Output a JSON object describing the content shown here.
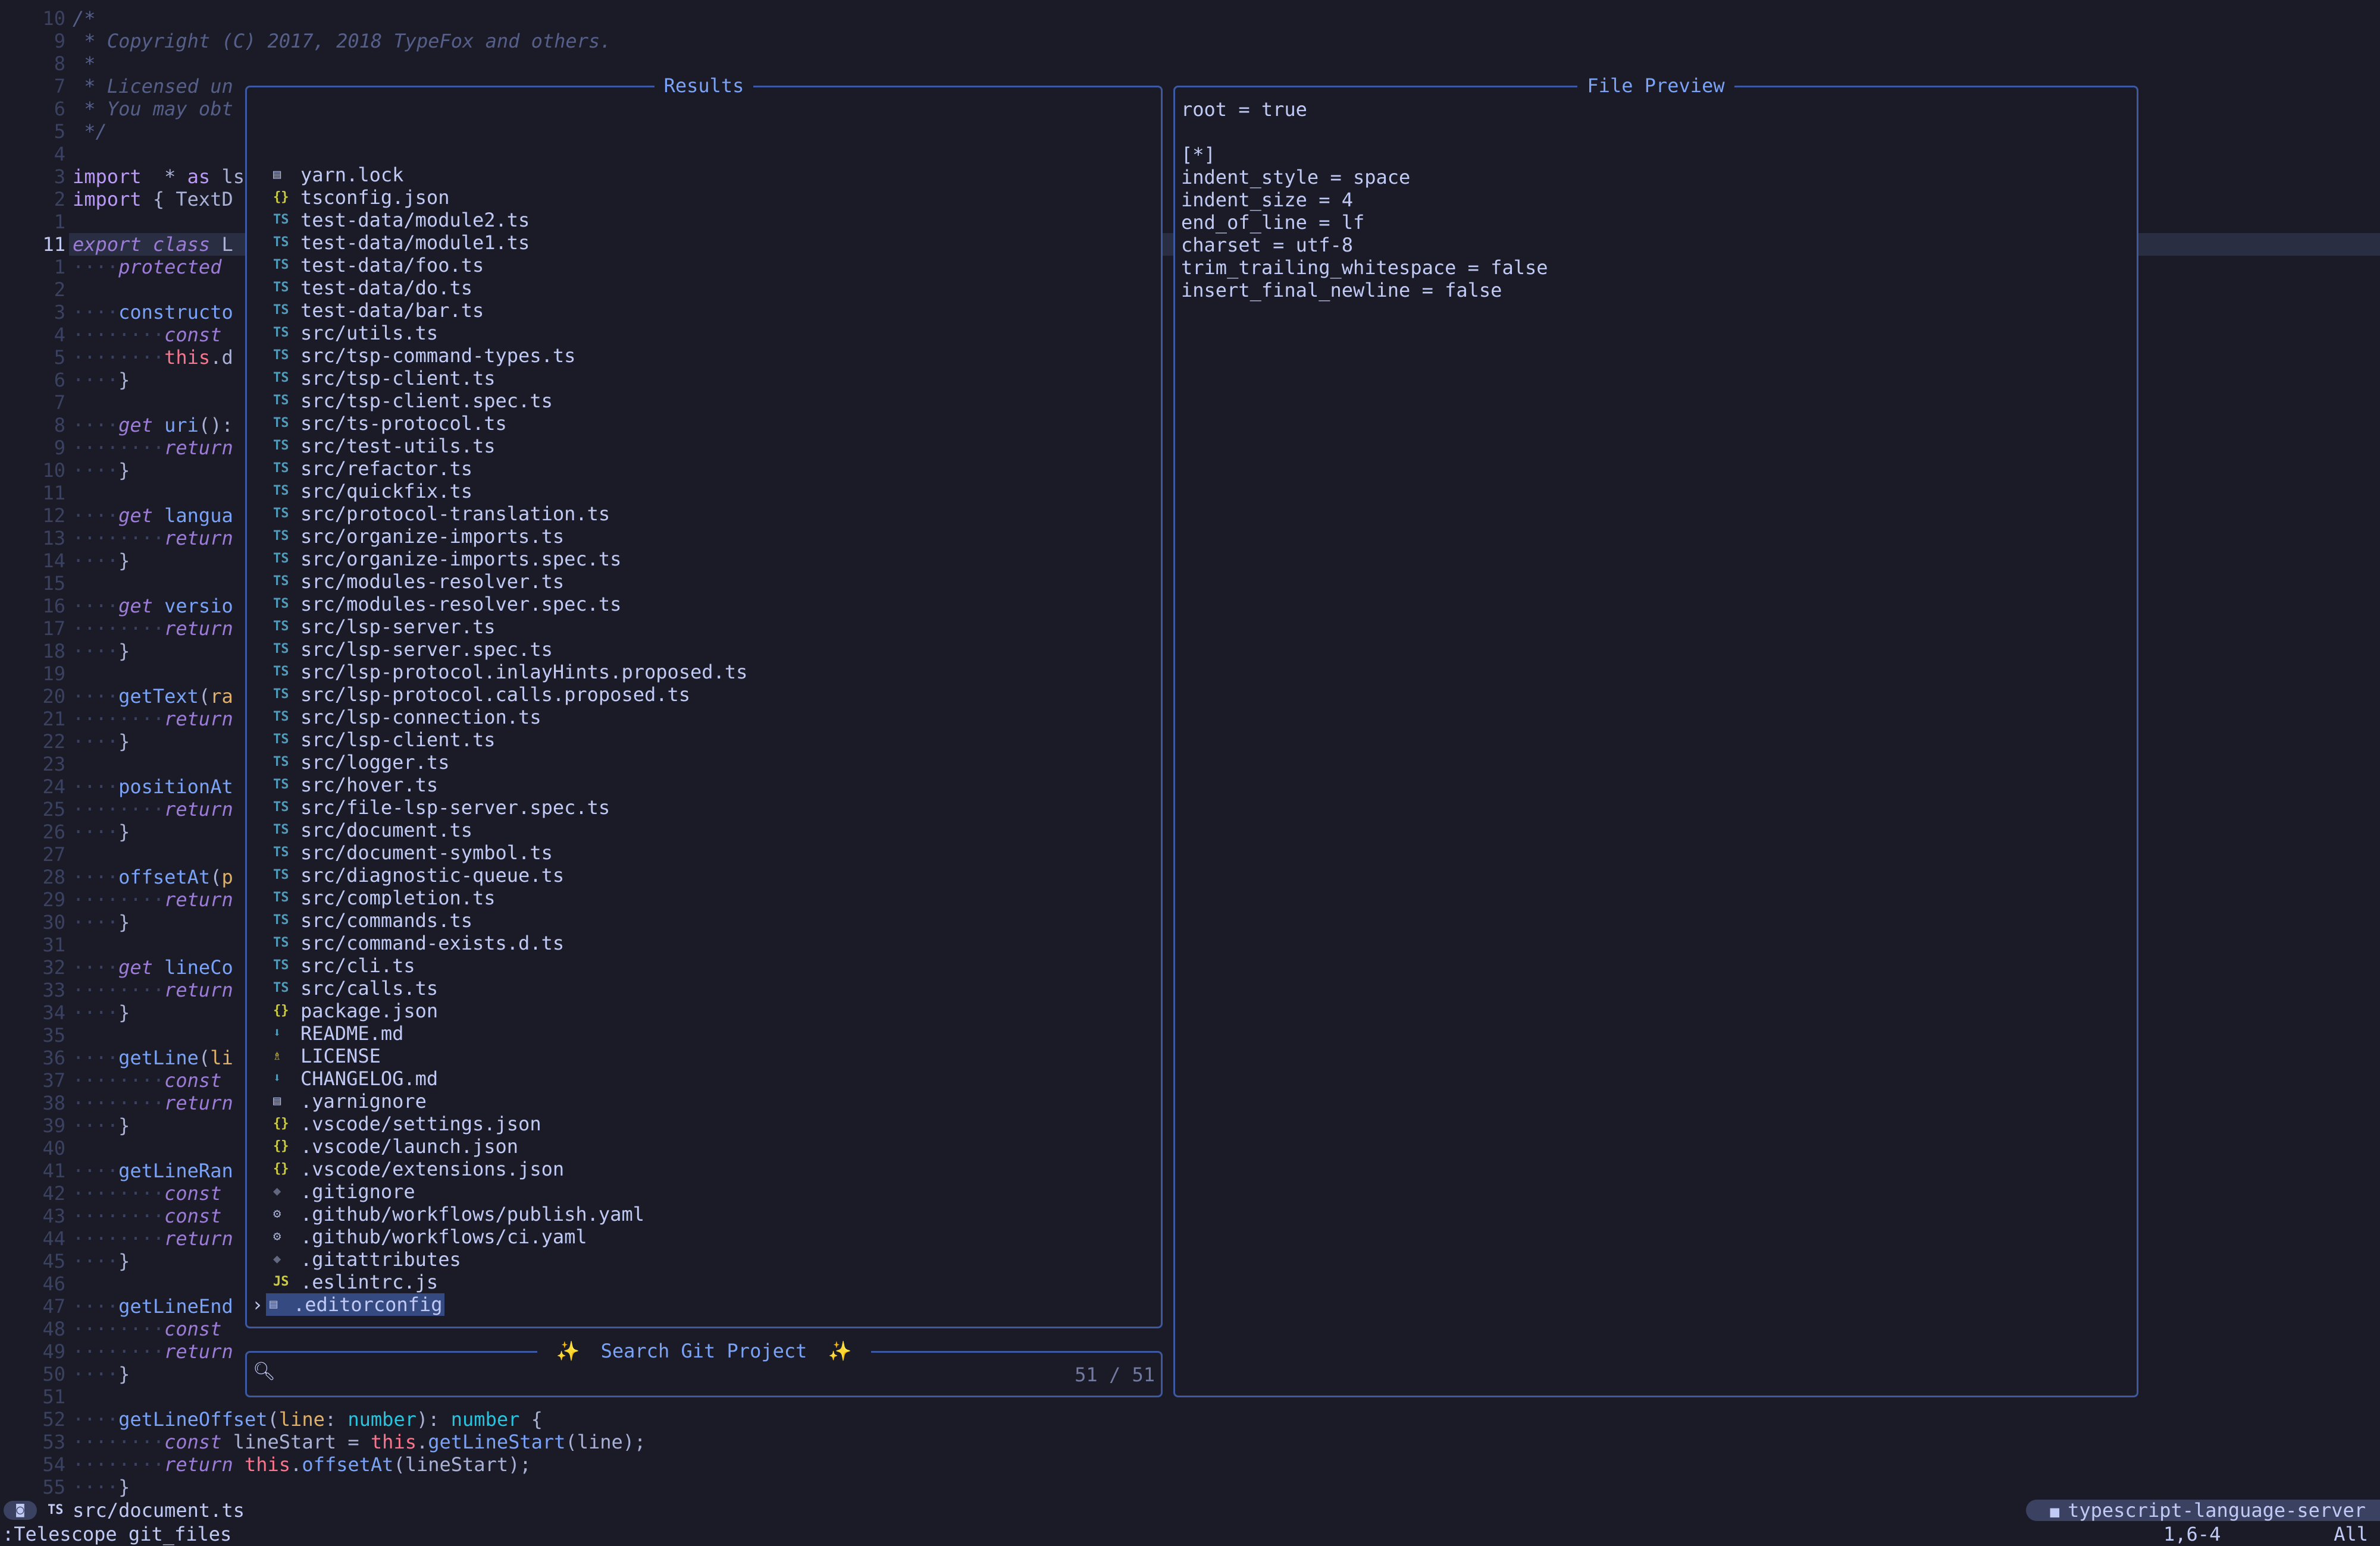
{
  "editor": {
    "line_numbers": [
      "10",
      "9",
      "8",
      "7",
      "6",
      "5",
      "4",
      "3",
      "2",
      "1",
      "11",
      "1",
      "2",
      "3",
      "4",
      "5",
      "6",
      "7",
      "8",
      "9",
      "10",
      "11",
      "12",
      "13",
      "14",
      "15",
      "16",
      "17",
      "18",
      "19",
      "20",
      "21",
      "22",
      "23",
      "24",
      "25",
      "26",
      "27",
      "28",
      "29",
      "30",
      "31",
      "32",
      "33",
      "34",
      "35",
      "36",
      "37",
      "38",
      "39",
      "40",
      "41",
      "42",
      "43",
      "44",
      "45",
      "46",
      "47",
      "48",
      "49",
      "50",
      "51",
      "52",
      "53",
      "54",
      "55"
    ],
    "lines": [
      [
        [
          "cm",
          "/*"
        ]
      ],
      [
        [
          "cm",
          " * Copyright (C) 2017, 2018 TypeFox and others."
        ]
      ],
      [
        [
          "cm",
          " *"
        ]
      ],
      [
        [
          "cm",
          " * Licensed un"
        ]
      ],
      [
        [
          "cm",
          " * You may obt"
        ]
      ],
      [
        [
          "cm",
          " */"
        ]
      ],
      [],
      [
        [
          "kw2",
          "import"
        ],
        [
          "",
          "  * "
        ],
        [
          "kw2",
          "as"
        ],
        [
          "",
          " ls"
        ]
      ],
      [
        [
          "kw2",
          "import"
        ],
        [
          "",
          " { TextD"
        ]
      ],
      [],
      [
        [
          "kw",
          "export class"
        ],
        [
          "",
          " L"
        ]
      ],
      [
        [
          "ws",
          "····"
        ],
        [
          "kw",
          "protected"
        ]
      ],
      [],
      [
        [
          "ws",
          "····"
        ],
        [
          "fn",
          "constructo"
        ]
      ],
      [
        [
          "ws",
          "········"
        ],
        [
          "kw",
          "const"
        ]
      ],
      [
        [
          "ws",
          "········"
        ],
        [
          "th",
          "this"
        ],
        [
          "",
          ".d"
        ]
      ],
      [
        [
          "ws",
          "····"
        ],
        [
          "",
          "}"
        ]
      ],
      [],
      [
        [
          "ws",
          "····"
        ],
        [
          "kw",
          "get"
        ],
        [
          "",
          " "
        ],
        [
          "fn",
          "uri"
        ],
        [
          "",
          "():"
        ]
      ],
      [
        [
          "ws",
          "········"
        ],
        [
          "kw",
          "return"
        ]
      ],
      [
        [
          "ws",
          "····"
        ],
        [
          "",
          "}"
        ]
      ],
      [],
      [
        [
          "ws",
          "····"
        ],
        [
          "kw",
          "get"
        ],
        [
          "",
          " "
        ],
        [
          "fn",
          "langua"
        ]
      ],
      [
        [
          "ws",
          "········"
        ],
        [
          "kw",
          "return"
        ]
      ],
      [
        [
          "ws",
          "····"
        ],
        [
          "",
          "}"
        ]
      ],
      [],
      [
        [
          "ws",
          "····"
        ],
        [
          "kw",
          "get"
        ],
        [
          "",
          " "
        ],
        [
          "fn",
          "versio"
        ]
      ],
      [
        [
          "ws",
          "········"
        ],
        [
          "kw",
          "return"
        ]
      ],
      [
        [
          "ws",
          "····"
        ],
        [
          "",
          "}"
        ]
      ],
      [],
      [
        [
          "ws",
          "····"
        ],
        [
          "fn",
          "getText"
        ],
        [
          "",
          "("
        ],
        [
          "pa",
          "ra"
        ]
      ],
      [
        [
          "ws",
          "········"
        ],
        [
          "kw",
          "return"
        ]
      ],
      [
        [
          "ws",
          "····"
        ],
        [
          "",
          "}"
        ]
      ],
      [],
      [
        [
          "ws",
          "····"
        ],
        [
          "fn",
          "positionAt"
        ]
      ],
      [
        [
          "ws",
          "········"
        ],
        [
          "kw",
          "return"
        ]
      ],
      [
        [
          "ws",
          "····"
        ],
        [
          "",
          "}"
        ]
      ],
      [],
      [
        [
          "ws",
          "····"
        ],
        [
          "fn",
          "offsetAt"
        ],
        [
          "",
          "("
        ],
        [
          "pa",
          "p"
        ]
      ],
      [
        [
          "ws",
          "········"
        ],
        [
          "kw",
          "return"
        ]
      ],
      [
        [
          "ws",
          "····"
        ],
        [
          "",
          "}"
        ]
      ],
      [],
      [
        [
          "ws",
          "····"
        ],
        [
          "kw",
          "get"
        ],
        [
          "",
          " "
        ],
        [
          "fn",
          "lineCo"
        ]
      ],
      [
        [
          "ws",
          "········"
        ],
        [
          "kw",
          "return"
        ]
      ],
      [
        [
          "ws",
          "····"
        ],
        [
          "",
          "}"
        ]
      ],
      [],
      [
        [
          "ws",
          "····"
        ],
        [
          "fn",
          "getLine"
        ],
        [
          "",
          "("
        ],
        [
          "pa",
          "li"
        ]
      ],
      [
        [
          "ws",
          "········"
        ],
        [
          "kw",
          "const"
        ]
      ],
      [
        [
          "ws",
          "········"
        ],
        [
          "kw",
          "return"
        ]
      ],
      [
        [
          "ws",
          "····"
        ],
        [
          "",
          "}"
        ]
      ],
      [],
      [
        [
          "ws",
          "····"
        ],
        [
          "fn",
          "getLineRan"
        ]
      ],
      [
        [
          "ws",
          "········"
        ],
        [
          "kw",
          "const"
        ]
      ],
      [
        [
          "ws",
          "········"
        ],
        [
          "kw",
          "const"
        ]
      ],
      [
        [
          "ws",
          "········"
        ],
        [
          "kw",
          "return"
        ]
      ],
      [
        [
          "ws",
          "····"
        ],
        [
          "",
          "}"
        ]
      ],
      [],
      [
        [
          "ws",
          "····"
        ],
        [
          "fn",
          "getLineEnd"
        ]
      ],
      [
        [
          "ws",
          "········"
        ],
        [
          "kw",
          "const"
        ]
      ],
      [
        [
          "ws",
          "········"
        ],
        [
          "kw",
          "return"
        ]
      ],
      [
        [
          "ws",
          "····"
        ],
        [
          "",
          "}"
        ]
      ],
      [],
      [
        [
          "ws",
          "····"
        ],
        [
          "fn",
          "getLineOffset"
        ],
        [
          "",
          "("
        ],
        [
          "pa",
          "line"
        ],
        [
          "",
          ": "
        ],
        [
          "ty",
          "number"
        ],
        [
          "",
          "): "
        ],
        [
          "ty",
          "number"
        ],
        [
          "",
          " {"
        ]
      ],
      [
        [
          "ws",
          "········"
        ],
        [
          "kw",
          "const"
        ],
        [
          "",
          " lineStart = "
        ],
        [
          "th",
          "this"
        ],
        [
          "",
          "."
        ],
        [
          "fn",
          "getLineStart"
        ],
        [
          "",
          "(line);"
        ]
      ],
      [
        [
          "ws",
          "········"
        ],
        [
          "kw",
          "return"
        ],
        [
          "",
          " "
        ],
        [
          "th",
          "this"
        ],
        [
          "",
          "."
        ],
        [
          "fn",
          "offsetAt"
        ],
        [
          "",
          "(lineStart);"
        ]
      ],
      [
        [
          "ws",
          "····"
        ],
        [
          "",
          "}"
        ]
      ]
    ]
  },
  "results": {
    "title": "Results",
    "items": [
      {
        "icon": "doc",
        "label": "yarn.lock"
      },
      {
        "icon": "json",
        "label": "tsconfig.json"
      },
      {
        "icon": "ts",
        "label": "test-data/module2.ts"
      },
      {
        "icon": "ts",
        "label": "test-data/module1.ts"
      },
      {
        "icon": "ts",
        "label": "test-data/foo.ts"
      },
      {
        "icon": "ts",
        "label": "test-data/do.ts"
      },
      {
        "icon": "ts",
        "label": "test-data/bar.ts"
      },
      {
        "icon": "ts",
        "label": "src/utils.ts"
      },
      {
        "icon": "ts",
        "label": "src/tsp-command-types.ts"
      },
      {
        "icon": "ts",
        "label": "src/tsp-client.ts"
      },
      {
        "icon": "ts",
        "label": "src/tsp-client.spec.ts"
      },
      {
        "icon": "ts",
        "label": "src/ts-protocol.ts"
      },
      {
        "icon": "ts",
        "label": "src/test-utils.ts"
      },
      {
        "icon": "ts",
        "label": "src/refactor.ts"
      },
      {
        "icon": "ts",
        "label": "src/quickfix.ts"
      },
      {
        "icon": "ts",
        "label": "src/protocol-translation.ts"
      },
      {
        "icon": "ts",
        "label": "src/organize-imports.ts"
      },
      {
        "icon": "ts",
        "label": "src/organize-imports.spec.ts"
      },
      {
        "icon": "ts",
        "label": "src/modules-resolver.ts"
      },
      {
        "icon": "ts",
        "label": "src/modules-resolver.spec.ts"
      },
      {
        "icon": "ts",
        "label": "src/lsp-server.ts"
      },
      {
        "icon": "ts",
        "label": "src/lsp-server.spec.ts"
      },
      {
        "icon": "ts",
        "label": "src/lsp-protocol.inlayHints.proposed.ts"
      },
      {
        "icon": "ts",
        "label": "src/lsp-protocol.calls.proposed.ts"
      },
      {
        "icon": "ts",
        "label": "src/lsp-connection.ts"
      },
      {
        "icon": "ts",
        "label": "src/lsp-client.ts"
      },
      {
        "icon": "ts",
        "label": "src/logger.ts"
      },
      {
        "icon": "ts",
        "label": "src/hover.ts"
      },
      {
        "icon": "ts",
        "label": "src/file-lsp-server.spec.ts"
      },
      {
        "icon": "ts",
        "label": "src/document.ts"
      },
      {
        "icon": "ts",
        "label": "src/document-symbol.ts"
      },
      {
        "icon": "ts",
        "label": "src/diagnostic-queue.ts"
      },
      {
        "icon": "ts",
        "label": "src/completion.ts"
      },
      {
        "icon": "ts",
        "label": "src/commands.ts"
      },
      {
        "icon": "ts",
        "label": "src/command-exists.d.ts"
      },
      {
        "icon": "ts",
        "label": "src/cli.ts"
      },
      {
        "icon": "ts",
        "label": "src/calls.ts"
      },
      {
        "icon": "json",
        "label": "package.json"
      },
      {
        "icon": "md",
        "label": "README.md"
      },
      {
        "icon": "lic",
        "label": "LICENSE"
      },
      {
        "icon": "md",
        "label": "CHANGELOG.md"
      },
      {
        "icon": "doc",
        "label": ".yarnignore"
      },
      {
        "icon": "json",
        "label": ".vscode/settings.json"
      },
      {
        "icon": "json",
        "label": ".vscode/launch.json"
      },
      {
        "icon": "json",
        "label": ".vscode/extensions.json"
      },
      {
        "icon": "git",
        "label": ".gitignore"
      },
      {
        "icon": "gear",
        "label": ".github/workflows/publish.yaml"
      },
      {
        "icon": "gear",
        "label": ".github/workflows/ci.yaml"
      },
      {
        "icon": "git",
        "label": ".gitattributes"
      },
      {
        "icon": "js",
        "label": ".eslintrc.js"
      },
      {
        "icon": "doc",
        "label": ".editorconfig",
        "selected": true
      }
    ]
  },
  "prompt": {
    "title": "Search Git Project",
    "star": "✨",
    "count": "51 / 51"
  },
  "preview": {
    "title": "File Preview",
    "lines": [
      "root = true",
      "",
      "[*]",
      "indent_style = space",
      "indent_size = 4",
      "end_of_line = lf",
      "charset = utf-8",
      "trim_trailing_whitespace = false",
      "insert_final_newline = false"
    ]
  },
  "statusline": {
    "filetype_icon": "TS",
    "file": "src/document.ts",
    "project": "typescript-language-server"
  },
  "cmdline": {
    "text": ":Telescope git_files",
    "position": "1,6-4",
    "scroll": "All"
  },
  "colors": {
    "background": "#1a1b26",
    "border": "#3d59a1",
    "accent": "#7aa2f7",
    "selection": "#364a82"
  }
}
